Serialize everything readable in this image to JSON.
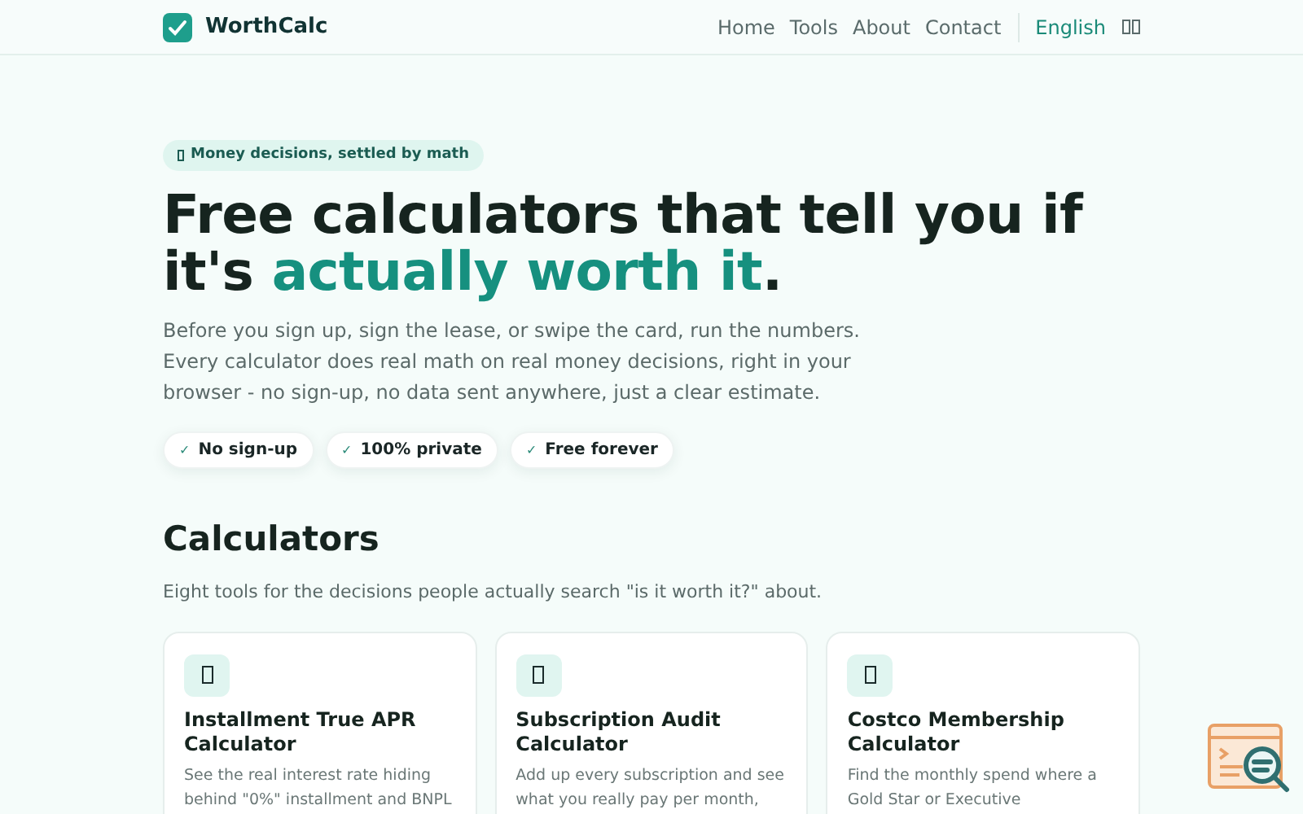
{
  "header": {
    "brand": "WorthCalc",
    "nav": [
      {
        "label": "Home"
      },
      {
        "label": "Tools"
      },
      {
        "label": "About"
      },
      {
        "label": "Contact"
      }
    ],
    "language": {
      "label": "English",
      "selected": true
    }
  },
  "hero": {
    "tag": "Money decisions, settled by math",
    "title_start": "Free calculators that tell you if it's ",
    "title_highlight": "actually worth it",
    "title_end": ".",
    "intro": "Before you sign up, sign the lease, or swipe the card, run the numbers. Every calculator does real math on real money decisions, right in your browser - no sign-up, no data sent anywhere, just a clear estimate.",
    "badges": [
      {
        "mark": "✓",
        "label": "No sign-up"
      },
      {
        "mark": "✓",
        "label": "100% private"
      },
      {
        "mark": "✓",
        "label": "Free forever"
      }
    ]
  },
  "calculators": {
    "heading": "Calculators",
    "subtitle": "Eight tools for the decisions people actually search \"is it worth it?\" about.",
    "cards": [
      {
        "title": "Installment True APR Calculator",
        "description": "See the real interest rate hiding behind \"0%\" installment and BNPL"
      },
      {
        "title": "Subscription Audit Calculator",
        "description": "Add up every subscription and see what you really pay per month,"
      },
      {
        "title": "Costco Membership Calculator",
        "description": "Find the monthly spend where a Gold Star or Executive"
      }
    ]
  }
}
